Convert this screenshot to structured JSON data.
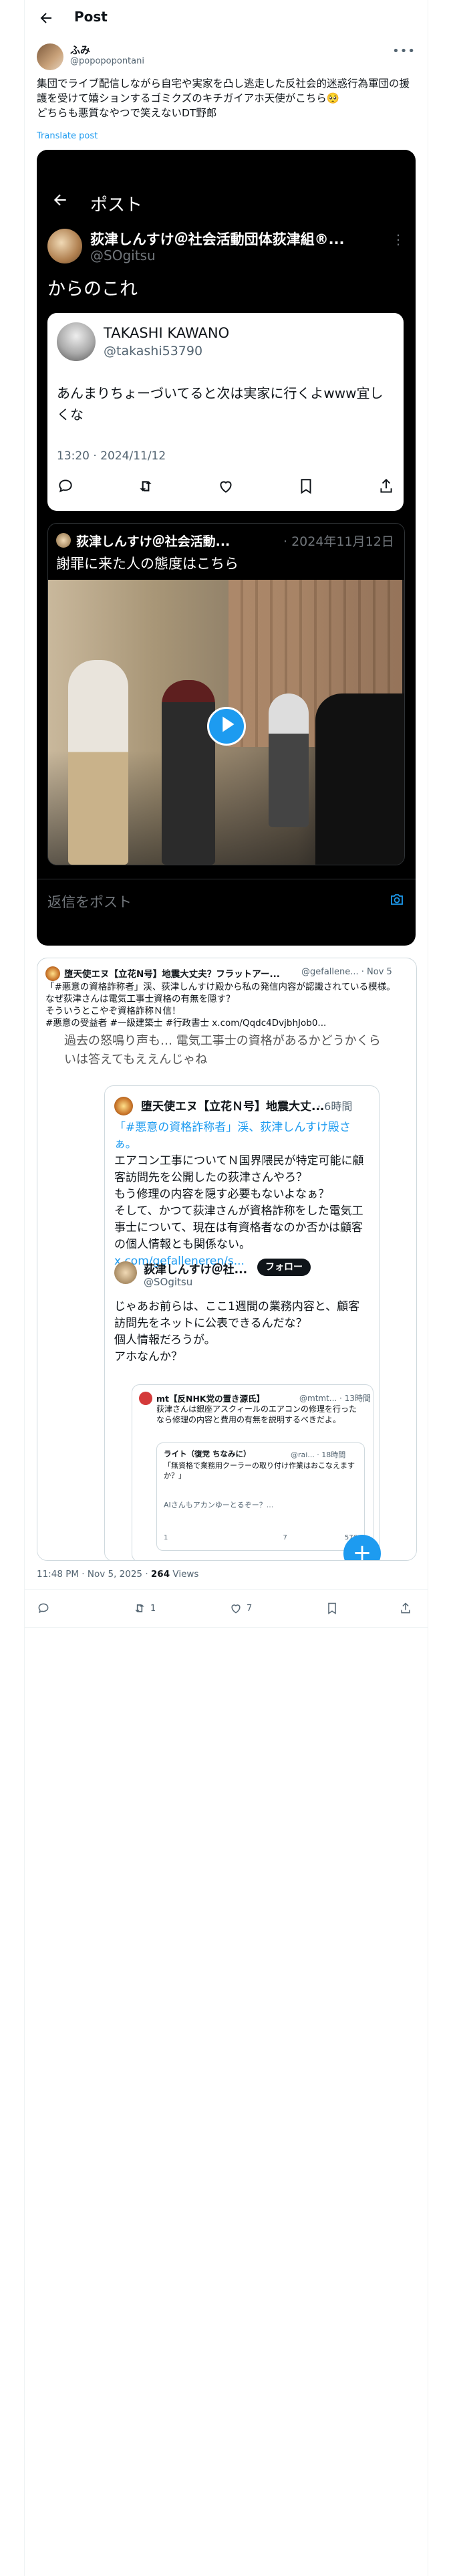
{
  "header": {
    "title": "Post"
  },
  "author": {
    "name": "ふみ",
    "handle": "@popopopontani"
  },
  "tweet": {
    "text": "集団でライブ配信しながら自宅や実家を凸し逃走した反社会的迷惑行為軍団の援護を受けて嬉ションするゴミクズのキチガイアホ天使がこちら🥺\nどちらも悪質なやつで笑えないDT野郎",
    "translate": "Translate post"
  },
  "screenshot": {
    "title": "ポスト",
    "name": "荻津しんすけ＠社会活動団体荻津組®...",
    "handle": "@SOgitsu",
    "text": "からのこれ",
    "quote": {
      "name": "TAKASHI KAWANO",
      "handle": "@takashi53790",
      "text": "あんまりちょーづいてると次は実家に行くよwww宜しくな",
      "time": "13:20 · 2024/11/12"
    },
    "embed": {
      "name": "荻津しんすけ＠社会活動...",
      "date": "· 2024年11月12日",
      "text": "謝罪に来た人の態度はこちら"
    },
    "reply_placeholder": "返信をポスト"
  },
  "quoted": {
    "name": "堕天使エヌ【立花N号】地震大丈夫？フラットアー...",
    "meta": "@gefallene... · Nov 5",
    "text": "「#悪意の資格詐称者」渓、荻津しんすけ殿から私の発信内容が認識されている模様。\nなぜ荻津さんは電気工事士資格の有無を隠す？\nそういうとこやぞ資格詐称Ｎ信！\n#悪意の受益者 #一級建築士 #行政書士 x.com/Qqdc4DvjbhJob0...",
    "image": {
      "prev_text": "過去の怒鳴り声も… 電気工事士の資格があるかどうかくらいは答えてもええんじゃね",
      "first": {
        "name": "堕天使エヌ【立花Ｎ号】地震大丈...",
        "time": "· 6時間",
        "text_a": "「#悪意の資格詐称者」渓、荻津しんすけ殿さぁ。",
        "text_b": "エアコン工事についてＮ国界隈民が特定可能に顧客訪問先を公開したの荻津さんやろ？\nもう修理の内容を隠す必要もないよなぁ？\nそして、かつて荻津さんが資格詐称をした電気工事士について、現在は有資格者なのか否かは顧客の個人情報とも関係ない。",
        "link": "x.com/gefalleneren/s..."
      },
      "second": {
        "name": "荻津しんすけ＠社...",
        "follow": "フォロー",
        "handle": "@SOgitsu",
        "text": "じゃあお前らは、ここ1週間の業務内容と、顧客訪問先をネットに公表できるんだな？\n個人情報だろうが。\nアホなんか？"
      },
      "nested": {
        "name": "mt【反NHK党の置き源氏】",
        "meta": "@mtmt... · 13時間",
        "text": "荻津さんは銀座アスクィールのエアコンの修理を行ったなら修理の内容と費用の有無を説明するべきだよ。",
        "sub_name": "ライト（復党 ちなみに）",
        "sub_meta": "@rai... · 18時間",
        "sub_text": "「無資格で業務用クーラーの取り付け作業はおこなえますか？」",
        "sub_ai": "AIさんもアカンゆーとるぞー？...",
        "sub_counts": [
          "1",
          "",
          "7",
          "576"
        ]
      }
    }
  },
  "footer": {
    "time": "11:48 PM · Nov 5, 2025 · ",
    "views_count": "264",
    "views_label": " Views",
    "reposts": "1",
    "likes": "7"
  }
}
